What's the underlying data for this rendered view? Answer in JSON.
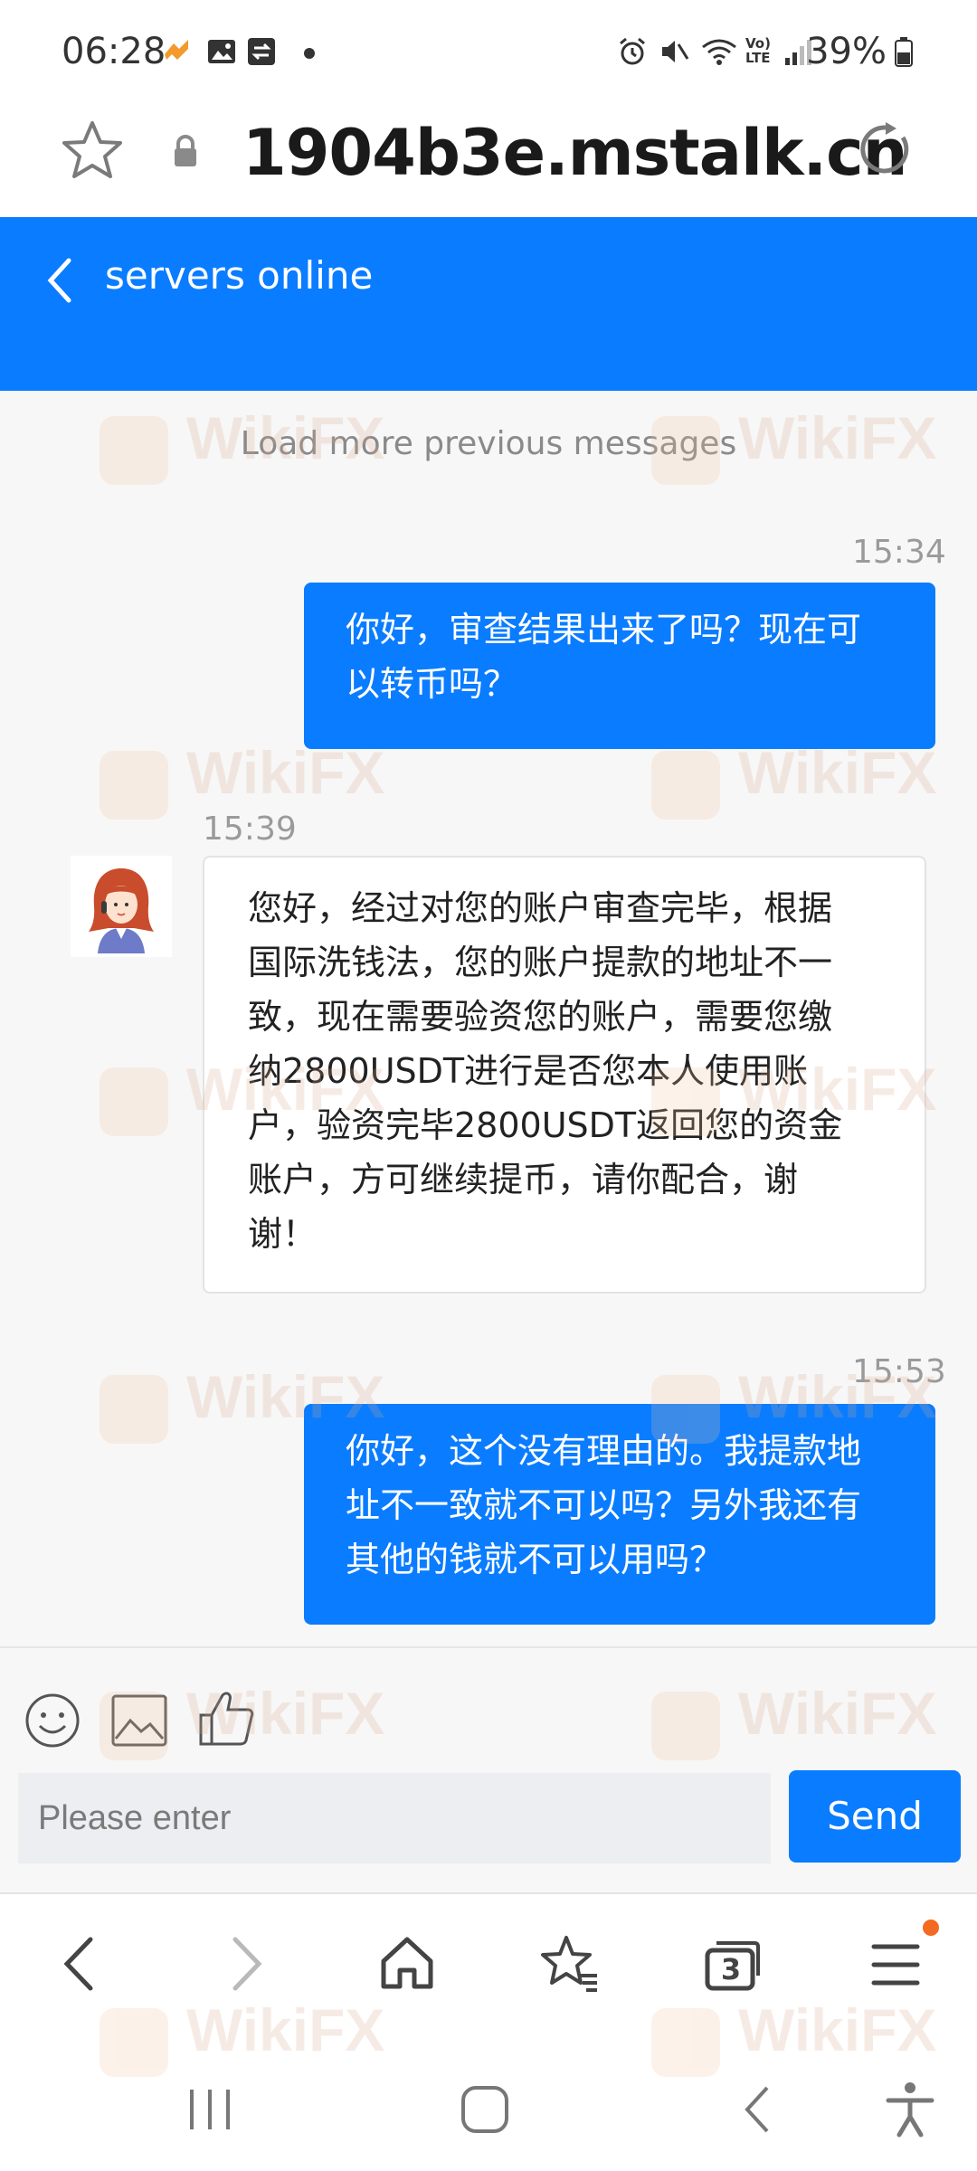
{
  "status_bar": {
    "time": "06:28",
    "battery": "39%"
  },
  "browser": {
    "url": "1904b3e.mstalk.cn"
  },
  "chat_header": {
    "title": "servers online"
  },
  "chat": {
    "load_more": "Load more previous messages",
    "messages": [
      {
        "side": "out",
        "time": "15:34",
        "lines": [
          "你好，审查结果出来了吗？现在可",
          "以转币吗？"
        ]
      },
      {
        "side": "in",
        "time": "15:39",
        "lines": [
          "您好，经过对您的账户审查完毕，根据",
          "国际洗钱法，您的账户提款的地址不一",
          "致，现在需要验资您的账户，需要您缴",
          "纳2800USDT进行是否您本人使用账",
          "户，验资完毕2800USDT返回您的资金",
          "账户，方可继续提币，请你配合，谢",
          "谢！"
        ]
      },
      {
        "side": "out",
        "time": "15:53",
        "lines": [
          "你好，这个没有理由的。我提款地",
          "址不一致就不可以吗？另外我还有",
          "其他的钱就不可以用吗？"
        ]
      }
    ]
  },
  "composer": {
    "placeholder": "Please enter",
    "send_label": "Send"
  },
  "browser_nav": {
    "tabs_count": "3"
  },
  "watermark": "WikiFX",
  "colors": {
    "accent": "#0a7cff",
    "chat_bg": "#f7f7f7"
  }
}
